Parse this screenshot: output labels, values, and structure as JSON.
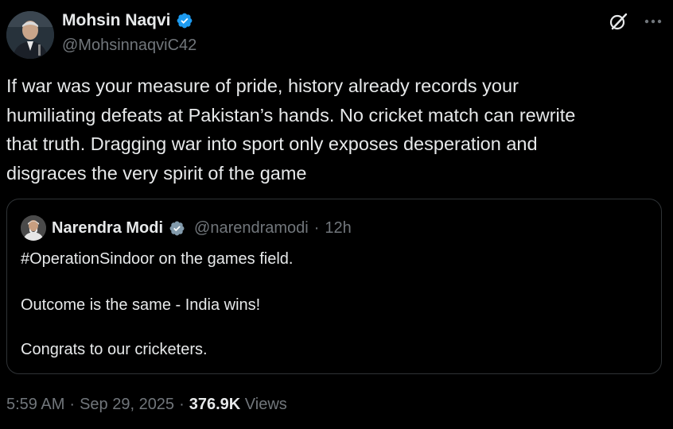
{
  "author": {
    "display_name": "Mohsin Naqvi",
    "handle": "@MohsinnaqviC42",
    "verified": true
  },
  "tweet": {
    "lines": [
      "If war was your measure of pride, history already records your",
      "humiliating defeats at Pakistan’s hands. No cricket match can rewrite",
      "that truth. Dragging war into sport only exposes desperation and",
      "disgraces the very spirit of the game"
    ]
  },
  "quote": {
    "display_name": "Narendra Modi",
    "handle": "@narendramodi",
    "separator": "·",
    "time_ago": "12h",
    "verified": true,
    "lines": [
      "#OperationSindoor on the games field.",
      "Outcome is the same - India wins!",
      "Congrats to our cricketers."
    ]
  },
  "meta": {
    "time": "5:59 AM",
    "dot1": "·",
    "date": "Sep 29, 2025",
    "dot2": "·",
    "views_count": "376.9K",
    "views_label": "Views"
  },
  "icons": {
    "verified": "verified-badge-icon",
    "grok": "grok-icon",
    "more": "more-options-icon"
  },
  "colors": {
    "background": "#000000",
    "text_primary": "#e7e9ea",
    "text_secondary": "#71767b",
    "verified_blue": "#1d9bf0",
    "border": "#2f3336"
  }
}
